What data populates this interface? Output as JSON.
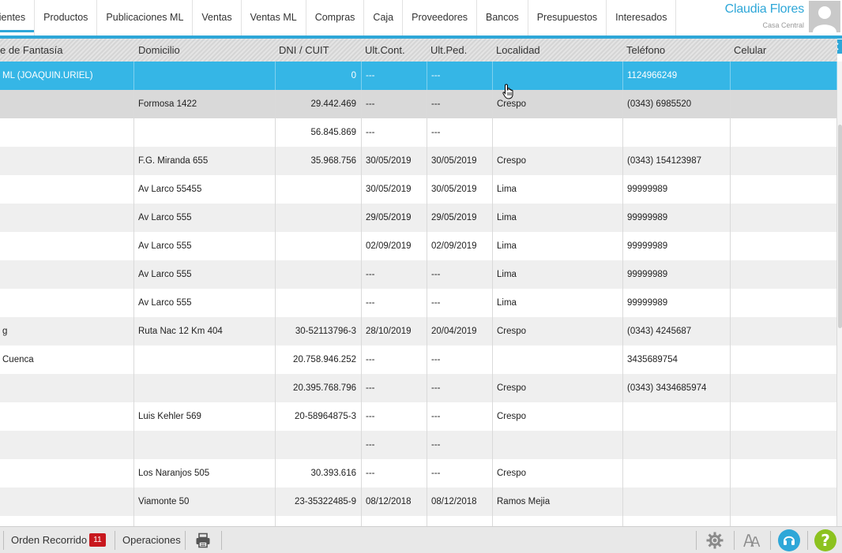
{
  "nav": {
    "tabs": [
      {
        "label": "lientes",
        "active": true
      },
      {
        "label": "Productos"
      },
      {
        "label": "Publicaciones ML"
      },
      {
        "label": "Ventas"
      },
      {
        "label": "Ventas ML"
      },
      {
        "label": "Compras"
      },
      {
        "label": "Caja"
      },
      {
        "label": "Proveedores"
      },
      {
        "label": "Bancos"
      },
      {
        "label": "Presupuestos"
      },
      {
        "label": "Interesados"
      }
    ],
    "user_name": "Claudia Flores",
    "user_branch": "Casa Central"
  },
  "table": {
    "columns": [
      "e de Fantasía",
      "Domicilio",
      "DNI / CUIT",
      "Ult.Cont.",
      "Ult.Ped.",
      "Localidad",
      "Teléfono",
      "Celular"
    ],
    "rows": [
      {
        "fantasia": "ML (JOAQUIN.URIEL)",
        "domicilio": "",
        "dni": "0",
        "ult_cont": "---",
        "ult_ped": "---",
        "localidad": "",
        "telefono": "1124966249",
        "celular": "",
        "state": "selected"
      },
      {
        "fantasia": "",
        "domicilio": "Formosa 1422",
        "dni": "29.442.469",
        "ult_cont": "---",
        "ult_ped": "---",
        "localidad": "Crespo",
        "telefono": "(0343) 6985520",
        "celular": "",
        "state": "hover"
      },
      {
        "fantasia": "",
        "domicilio": "",
        "dni": "56.845.869",
        "ult_cont": "---",
        "ult_ped": "---",
        "localidad": "",
        "telefono": "",
        "celular": ""
      },
      {
        "fantasia": "",
        "domicilio": "F.G. Miranda 655",
        "dni": "35.968.756",
        "ult_cont": "30/05/2019",
        "ult_ped": "30/05/2019",
        "localidad": "Crespo",
        "telefono": "(0343) 154123987",
        "celular": ""
      },
      {
        "fantasia": "",
        "domicilio": "Av Larco 55455",
        "dni": "",
        "ult_cont": "30/05/2019",
        "ult_ped": "30/05/2019",
        "localidad": "Lima",
        "telefono": "99999989",
        "celular": ""
      },
      {
        "fantasia": "",
        "domicilio": "Av Larco 555",
        "dni": "",
        "ult_cont": "29/05/2019",
        "ult_ped": "29/05/2019",
        "localidad": "Lima",
        "telefono": "99999989",
        "celular": ""
      },
      {
        "fantasia": "",
        "domicilio": "Av Larco 555",
        "dni": "",
        "ult_cont": "02/09/2019",
        "ult_ped": "02/09/2019",
        "localidad": "Lima",
        "telefono": "99999989",
        "celular": ""
      },
      {
        "fantasia": "",
        "domicilio": "Av Larco 555",
        "dni": "",
        "ult_cont": "---",
        "ult_ped": "---",
        "localidad": "Lima",
        "telefono": "99999989",
        "celular": ""
      },
      {
        "fantasia": "",
        "domicilio": "Av Larco 555",
        "dni": "",
        "ult_cont": "---",
        "ult_ped": "---",
        "localidad": "Lima",
        "telefono": "99999989",
        "celular": ""
      },
      {
        "fantasia": "g",
        "domicilio": "Ruta Nac 12 Km 404",
        "dni": "30-52113796-3",
        "ult_cont": "28/10/2019",
        "ult_ped": "20/04/2019",
        "localidad": "Crespo",
        "telefono": "(0343) 4245687",
        "celular": ""
      },
      {
        "fantasia": "Cuenca",
        "domicilio": "",
        "dni": "20.758.946.252",
        "ult_cont": "---",
        "ult_ped": "---",
        "localidad": "",
        "telefono": "3435689754",
        "celular": ""
      },
      {
        "fantasia": "",
        "domicilio": "",
        "dni": "20.395.768.796",
        "ult_cont": "---",
        "ult_ped": "---",
        "localidad": "Crespo",
        "telefono": "(0343) 3434685974",
        "celular": ""
      },
      {
        "fantasia": "",
        "domicilio": "Luis Kehler 569",
        "dni": "20-58964875-3",
        "ult_cont": "---",
        "ult_ped": "---",
        "localidad": "Crespo",
        "telefono": "",
        "celular": ""
      },
      {
        "fantasia": "",
        "domicilio": "",
        "dni": "",
        "ult_cont": "---",
        "ult_ped": "---",
        "localidad": "",
        "telefono": "",
        "celular": ""
      },
      {
        "fantasia": "",
        "domicilio": "Los Naranjos 505",
        "dni": "30.393.616",
        "ult_cont": "---",
        "ult_ped": "---",
        "localidad": "Crespo",
        "telefono": "",
        "celular": ""
      },
      {
        "fantasia": "",
        "domicilio": "Viamonte 50",
        "dni": "23-35322485-9",
        "ult_cont": "08/12/2018",
        "ult_ped": "08/12/2018",
        "localidad": "Ramos Mejia",
        "telefono": "",
        "celular": ""
      },
      {
        "fantasia": "",
        "domicilio": "",
        "dni": "",
        "ult_cont": "",
        "ult_ped": "",
        "localidad": "",
        "telefono": "",
        "celular": ""
      }
    ]
  },
  "bottom": {
    "orden_label": "Orden Recorrido",
    "orden_count": "11",
    "operaciones_label": "Operaciones",
    "print_icon": "printer-icon",
    "settings_icon": "gear-icon",
    "font_icon": "font-size-icon",
    "support_icon": "headset-icon",
    "help_label": "?"
  },
  "colors": {
    "accent": "#2ea7d8",
    "selected_row": "#35b6e6",
    "badge": "#c8181e",
    "help": "#8cc21f"
  }
}
